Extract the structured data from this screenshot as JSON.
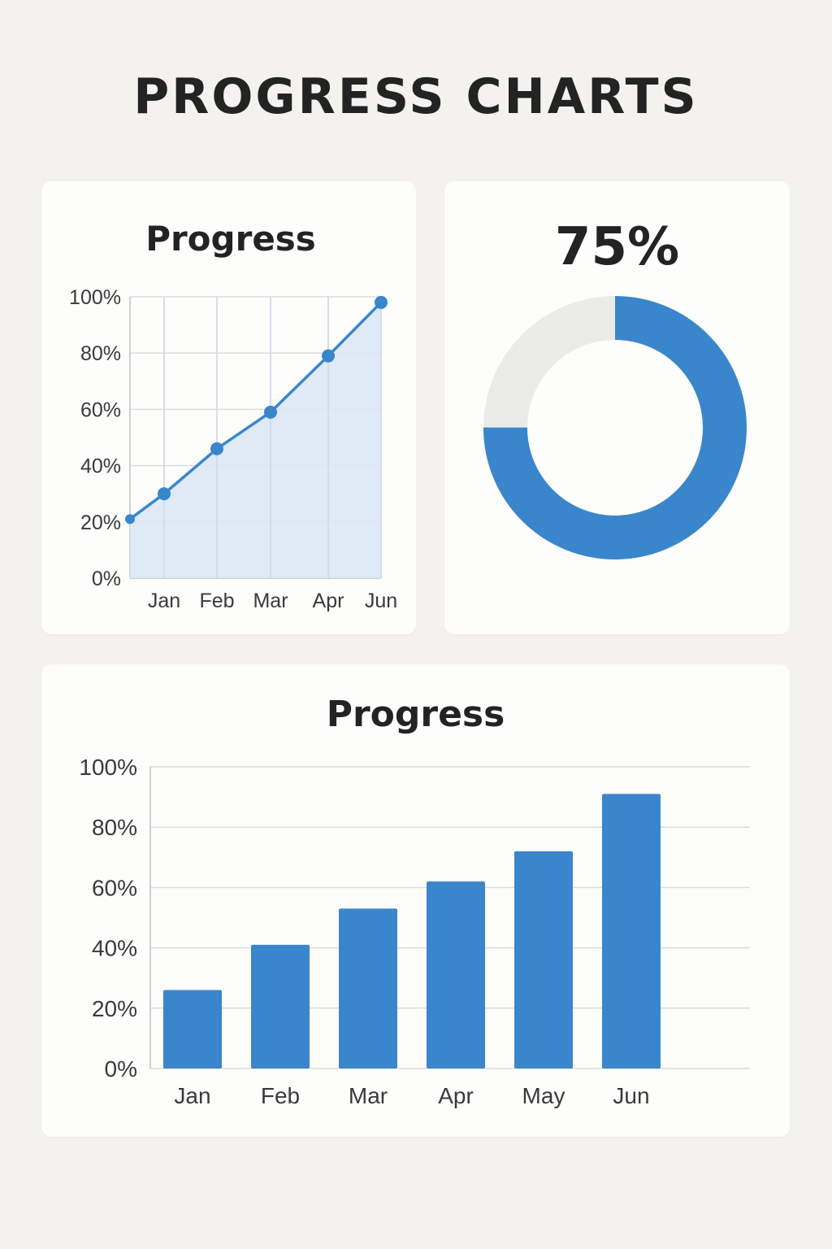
{
  "title": "PROGRESS CHARTS",
  "chart_data": [
    {
      "type": "line",
      "title": "Progress",
      "categories": [
        "Jan",
        "Feb",
        "Mar",
        "Apr",
        "Jun"
      ],
      "values": [
        21,
        30,
        46,
        59,
        79,
        98
      ],
      "x_tick_labels": [
        "Jan",
        "Feb",
        "Mar",
        "Apr",
        "Jun"
      ],
      "y_tick_labels": [
        "0%",
        "20%",
        "40%",
        "60%",
        "80%",
        "100%"
      ],
      "ylim": [
        0,
        100
      ],
      "grid": true,
      "area_fill": true,
      "color": "#3a86cc",
      "fill_color": "#dbe6f4"
    },
    {
      "type": "pie",
      "label": "75%",
      "value": 75,
      "remainder": 25,
      "donut": true,
      "color": "#3a86cc",
      "track_color": "#ebebe8"
    },
    {
      "type": "bar",
      "title": "Progress",
      "categories": [
        "Jan",
        "Feb",
        "Mar",
        "Apr",
        "May",
        "Jun"
      ],
      "values": [
        26,
        41,
        53,
        62,
        72,
        91
      ],
      "y_tick_labels": [
        "0%",
        "20%",
        "40%",
        "60%",
        "80%",
        "100%"
      ],
      "ylim": [
        0,
        100
      ],
      "grid": true,
      "color": "#3a86cc"
    }
  ]
}
